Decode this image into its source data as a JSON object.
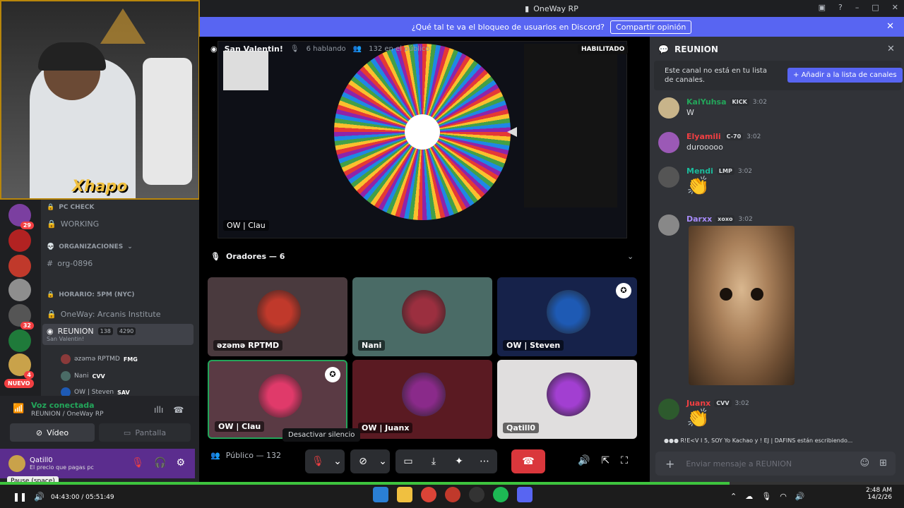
{
  "window": {
    "title": "OneWay RP"
  },
  "banner": {
    "text": "¿Qué tal te va el bloqueo de usuarios en Discord?",
    "button": "Compartir opinión"
  },
  "webcam": {
    "brand": "Xhapo"
  },
  "servers": {
    "badges": [
      "29",
      "32",
      "4"
    ],
    "nuevo": "NUEVO"
  },
  "channels": {
    "items": [
      "PC CHECK",
      "WORKING",
      "ORGANIZACIONES",
      "org-0896",
      "HORARIO: 5PM (NYC)",
      "OneWay: Arcanis Institute"
    ],
    "active": {
      "name": "REUNION",
      "sub": "San Valentin!",
      "count1": "138",
      "count2": "4290"
    },
    "voice_users": [
      {
        "name": "ǝzǝmǝ RPTMD",
        "tag": "FMG"
      },
      {
        "name": "Nani",
        "tag": "CVV"
      },
      {
        "name": "OW | Steven",
        "tag": "SAV"
      }
    ]
  },
  "voice": {
    "status": "Voz conectada",
    "location": "REUNION / OneWay RP",
    "video": "Vídeo",
    "screen": "Pantalla"
  },
  "user": {
    "name": "Qatill0",
    "status": "El precio que pagas pc"
  },
  "stage": {
    "title": "San Valentin!",
    "speaking": "6 hablando",
    "audience": "132 en el público",
    "enabled": "HABILITADO",
    "screen_owner": "OW | Clau",
    "speakers_label": "Oradores — 6",
    "public_label": "Público — 132",
    "tooltip": "Desactivar silencio"
  },
  "tiles": [
    {
      "name": "ǝzǝmǝ RPTMD",
      "bg": "#4a3a3e",
      "av": "#c0392b"
    },
    {
      "name": "Nani",
      "bg": "#4a6b66",
      "av": "#9b2f3f"
    },
    {
      "name": "OW | Steven",
      "bg": "#16224a",
      "av": "#1e5ab4"
    },
    {
      "name": "OW | Clau",
      "bg": "#5a3a44",
      "av": "#e03a6a"
    },
    {
      "name": "OW | Juanx",
      "bg": "#5a1a22",
      "av": "#8a2a8a"
    },
    {
      "name": "Qatill0",
      "bg": "#e0dede",
      "av": "#a23fd1"
    }
  ],
  "chat": {
    "title": "REUNION",
    "notice": "Este canal no está en tu lista de canales.",
    "add_button": "Añadir a la lista de canales",
    "messages": [
      {
        "author": "KaiYuhsa",
        "color": "#23a55a",
        "role": "KICK",
        "time": "3:02",
        "text": "W"
      },
      {
        "author": "Elyamili",
        "color": "#f23f42",
        "role": "C-70",
        "time": "3:02",
        "text": "durooooo"
      },
      {
        "author": "Mendi",
        "color": "#1abc9c",
        "role": "LMP",
        "time": "3:02",
        "text": ""
      },
      {
        "author": "Darxx",
        "color": "#a78bfa",
        "role": "xoxo",
        "time": "3:02",
        "text": ""
      },
      {
        "author": "Juanx",
        "color": "#f23f42",
        "role": "CVV",
        "time": "3:02",
        "text": ""
      }
    ],
    "typing": "R!E<V I 5, SOY Yo Kachao y ! EJ | DAFINS están escribiendo...",
    "input_placeholder": "Enviar mensaje a REUNION"
  },
  "player": {
    "time": "04:43:00 / 05:51:49",
    "pause_tip": "Pause (space)",
    "progress": 0.807
  },
  "clock": {
    "time": "2:48 AM",
    "date": "14/2/26"
  },
  "colors": {
    "discord_blurple": "#5865f2",
    "hangup": "#da373c",
    "online": "#23a55a"
  }
}
